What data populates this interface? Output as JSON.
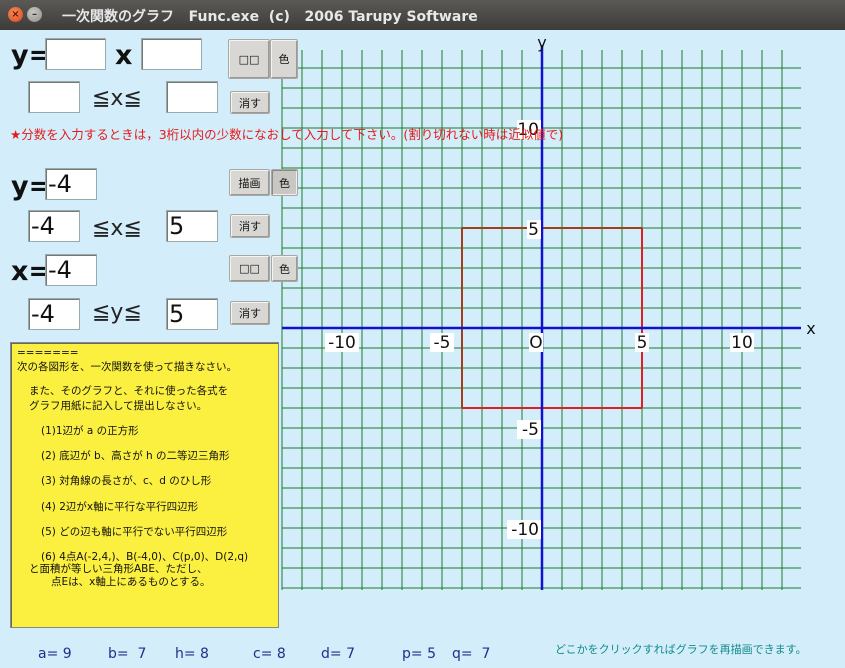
{
  "window": {
    "title": "一次関数のグラフ   Func.exe  (c)   2006 Tarupy Software",
    "close_glyph": "×",
    "minimize_glyph": "–"
  },
  "row1": {
    "y_label": "y=",
    "x_label": "x",
    "slope_value": "",
    "intercept_value": "",
    "draw_label": "□□",
    "color_label": "色",
    "range_from": "",
    "range_mid": "≦x≦",
    "range_to": "",
    "erase_label": "消す"
  },
  "note": "★分数を入力するときは，3桁以内の少数になおして入力して下さい。(割り切れない時は近似値で)",
  "row2": {
    "y_label": "y=",
    "value": "-4",
    "draw_label": "描画",
    "color_label": "色",
    "range_from": "-4",
    "range_mid": "≦x≦",
    "range_to": "5",
    "erase_label": "消す"
  },
  "row3": {
    "x_label": "x=",
    "value": "-4",
    "draw_label": "□□",
    "color_label": "色",
    "range_from": "-4",
    "range_mid": "≦y≦",
    "range_to": "5",
    "erase_label": "消す"
  },
  "panel": {
    "lines": [
      "=======",
      "次の各図形を、一次関数を使って描きなさい。",
      "また、そのグラフと、それに使った各式を",
      "グラフ用紙に記入して提出しなさい。",
      "(1)1辺が a の正方形",
      "(2) 底辺が b、高さが h の二等辺三角形",
      "(3) 対角線の長さが、c、d のひし形",
      "(4) 2辺がx軸に平行な平行四辺形",
      "(5) どの辺も軸に平行でない平行四辺形",
      "(6) 4点A(-2,4,)、B(-4,0)、C(p,0)、D(2,q)",
      "と面積が等しい三角形ABE、ただし、",
      "点Eは、x軸上にあるものとする。"
    ]
  },
  "status": {
    "a": "a= 9",
    "b": "b=  7",
    "h": "h= 8",
    "c": "c= 8",
    "d": "d= 7",
    "p": "p= 5",
    "q": "q=  7",
    "hint": "どこかをクリックすればグラフを再描画できます。"
  },
  "colors": {
    "grid": "#1f7a2a",
    "axis": "#1010d0",
    "series_y": "#e02020",
    "series_x": "#b03010",
    "panel": "#fbf03f",
    "background": "#d3eefa"
  },
  "chart_data": {
    "type": "line",
    "x_label": "x",
    "y_label": "y",
    "origin_label": "O",
    "xlim": [
      -13,
      13
    ],
    "ylim": [
      -13,
      10
    ],
    "grid": true,
    "x_tick_labels": [
      {
        "value": -10,
        "label": "-10"
      },
      {
        "value": -5,
        "label": "-5"
      },
      {
        "value": 5,
        "label": "5"
      },
      {
        "value": 10,
        "label": "10"
      }
    ],
    "y_tick_labels": [
      {
        "value": 10,
        "label": "10"
      },
      {
        "value": 5,
        "label": "5"
      },
      {
        "value": -5,
        "label": "-5"
      },
      {
        "value": -10,
        "label": "-10"
      }
    ],
    "series": [
      {
        "points": [
          [
            -4,
            5
          ],
          [
            5,
            5
          ]
        ],
        "color": "#a0401a"
      },
      {
        "points": [
          [
            -4,
            5
          ],
          [
            -4,
            -4
          ]
        ],
        "color": "#a0401a"
      },
      {
        "points": [
          [
            -4,
            -4
          ],
          [
            5,
            -4
          ]
        ],
        "color": "#e02020"
      },
      {
        "points": [
          [
            5,
            5
          ],
          [
            5,
            -4
          ]
        ],
        "color": "#e02020"
      }
    ]
  }
}
